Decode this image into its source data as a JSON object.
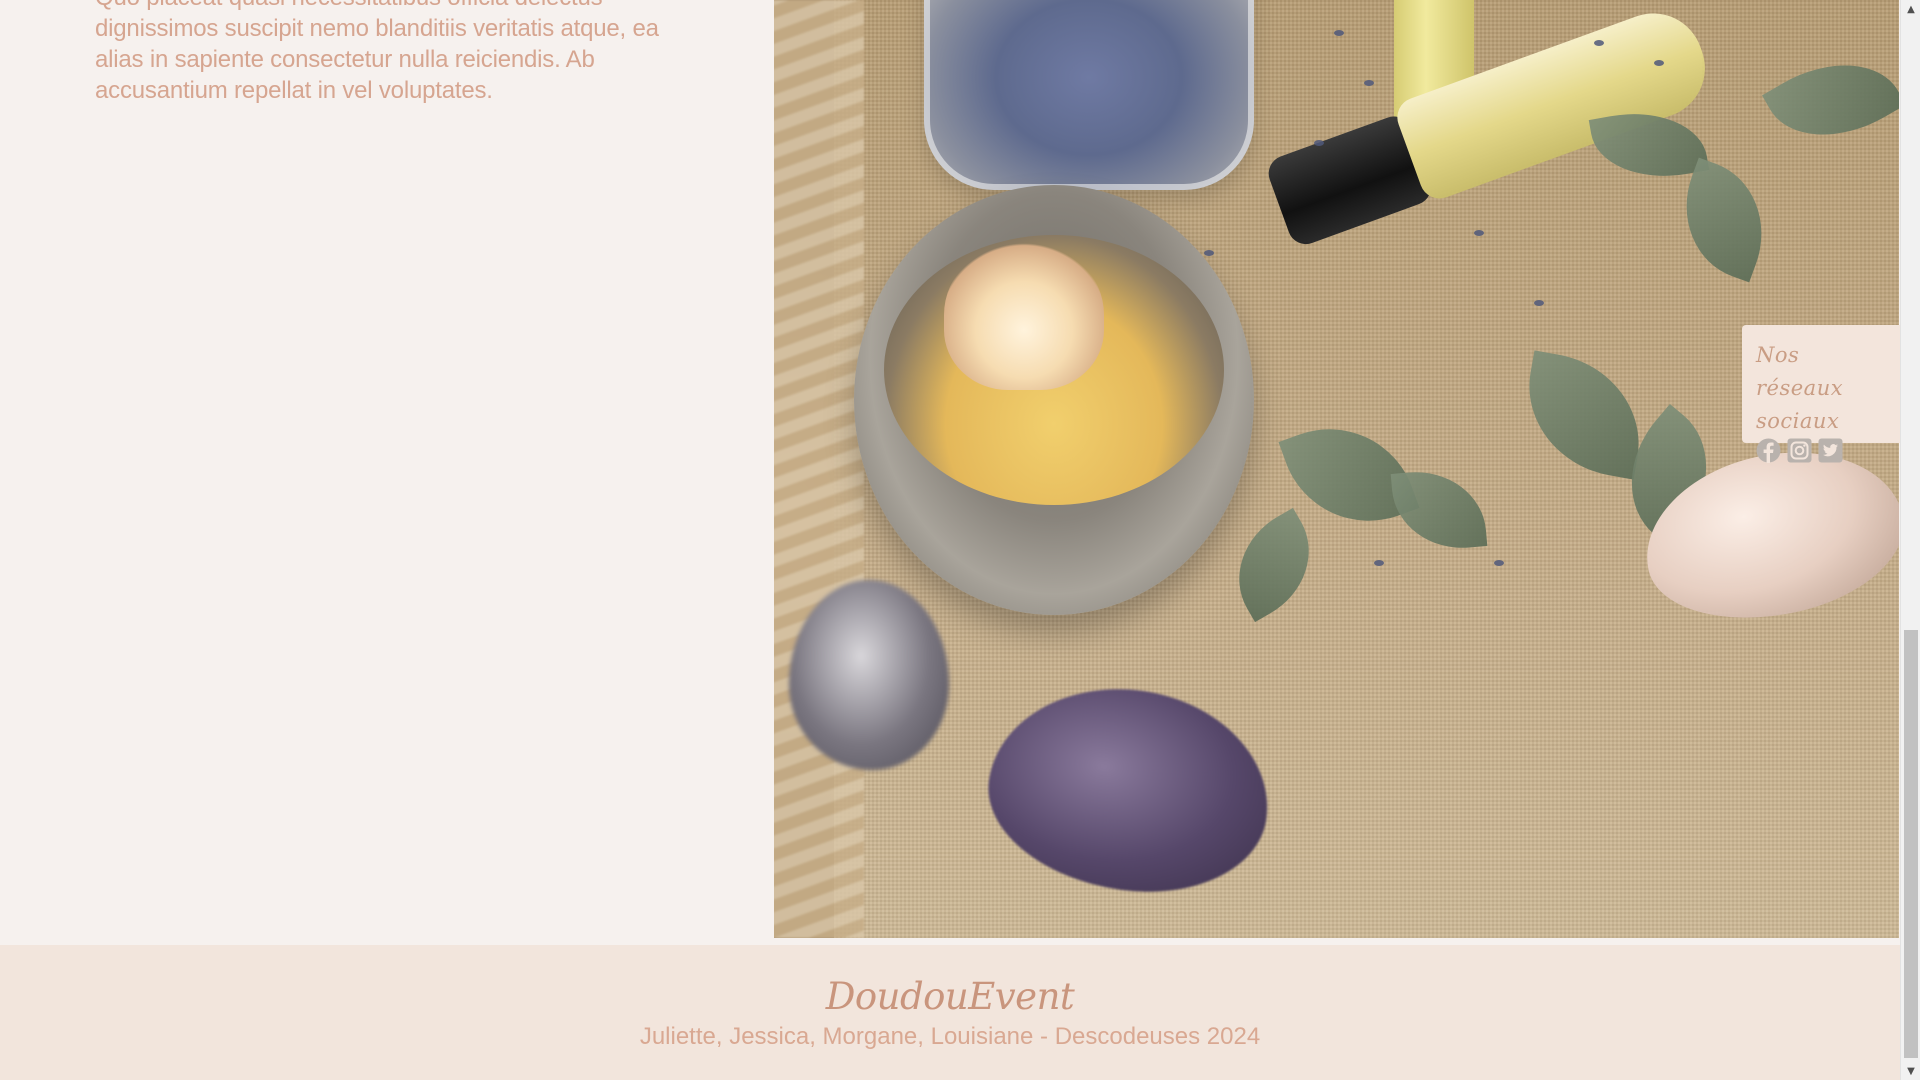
{
  "content": {
    "paragraph": "Quo placeat quasi necessitatibus officia delectus dignissimos suscipit nemo blanditiis veritatis atque, ea alias in sapiente consectetur nulla reiciendis. Ab accusantium repellat in vel voluptates."
  },
  "social": {
    "title": "Nos réseaux sociaux",
    "icons": [
      "facebook-icon",
      "instagram-icon",
      "twitter-icon"
    ]
  },
  "footer": {
    "brand": "DoudouEvent",
    "credits": "Juliette, Jessica, Morgane, Louisiane - Descodeuses 2024"
  },
  "colors": {
    "page_bg": "#f6f1ee",
    "text_accent": "#d6a590",
    "footer_bg": "#f2e5dc",
    "social_bg": "#f3e5dc",
    "icon": "#b9b2ad"
  }
}
